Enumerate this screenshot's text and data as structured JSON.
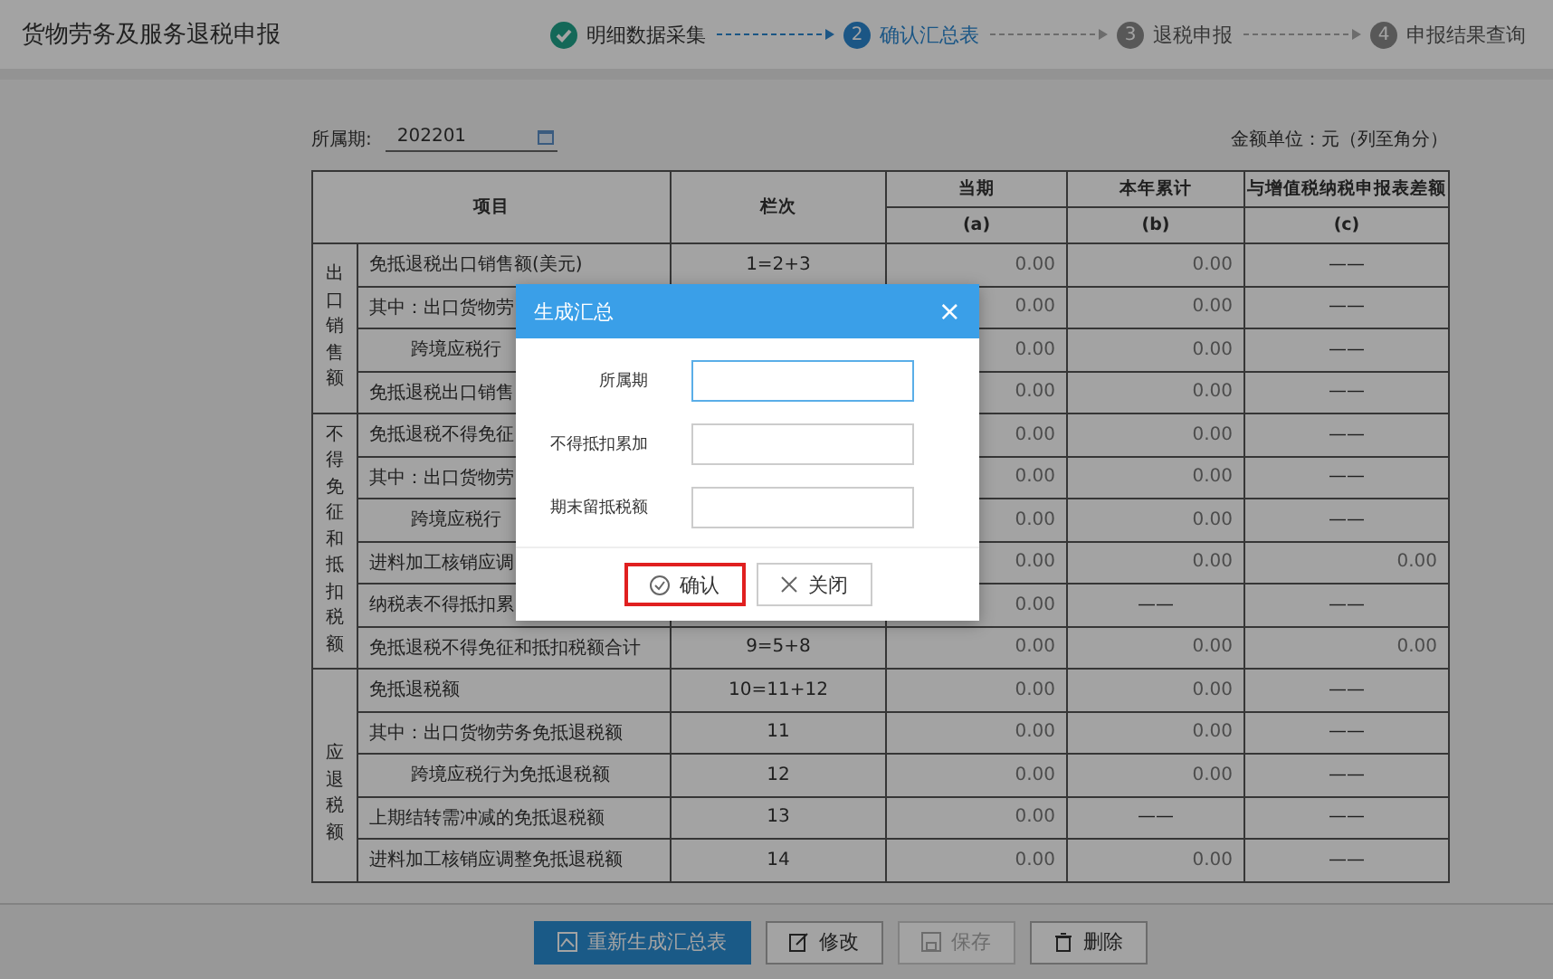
{
  "header": {
    "title": "货物劳务及服务退税申报",
    "steps": [
      {
        "label": "明细数据采集",
        "completed": true,
        "selected": false
      },
      {
        "number": "2",
        "label": "确认汇总表",
        "completed": false,
        "selected": true
      },
      {
        "number": "3",
        "label": "退税申报",
        "completed": false,
        "selected": false
      },
      {
        "number": "4",
        "label": "申报结果查询",
        "completed": false,
        "selected": false
      }
    ]
  },
  "period": {
    "label": "所属期:",
    "value": "202201"
  },
  "unit_note": "金额单位：元（列至角分）",
  "table": {
    "columns": {
      "item": "项目",
      "line": "栏次",
      "a": "当期",
      "b": "本年累计",
      "c": "与增值税纳税申报表差额"
    },
    "subheaders": [
      "(a)",
      "(b)",
      "(c)"
    ],
    "groups": [
      {
        "label": "出口销售额",
        "rows": [
          {
            "item": "免抵退税出口销售额(美元)",
            "kind": "plain",
            "line": "1=2+3",
            "a": "0.00",
            "b": "0.00",
            "c": "——"
          },
          {
            "item": "其中：出口货物劳",
            "kind": "plain",
            "a": "0.00",
            "b": "0.00",
            "c": "——"
          },
          {
            "item": "跨境应税行",
            "kind": "indented",
            "a": "0.00",
            "b": "0.00",
            "c": "——"
          },
          {
            "item": "免抵退税出口销售",
            "kind": "plain",
            "a": "0.00",
            "b": "0.00",
            "c": "——"
          }
        ]
      },
      {
        "label": "不得免征和抵扣税额",
        "rows": [
          {
            "item": "免抵退税不得免征",
            "kind": "plain",
            "a": "0.00",
            "b": "0.00",
            "c": "——"
          },
          {
            "item": "其中：出口货物劳",
            "kind": "plain",
            "a": "0.00",
            "b": "0.00",
            "c": "——"
          },
          {
            "item": "跨境应税行",
            "kind": "indented",
            "a": "0.00",
            "b": "0.00",
            "c": "——"
          },
          {
            "item": "进料加工核销应调",
            "kind": "plain",
            "a": "0.00",
            "b": "0.00",
            "c": "0.00"
          },
          {
            "item": "纳税表不得抵扣累",
            "kind": "plain",
            "a": "0.00",
            "b": "——",
            "c": "——"
          },
          {
            "item": "免抵退税不得免征和抵扣税额合计",
            "kind": "plain",
            "line": "9=5+8",
            "a": "0.00",
            "b": "0.00",
            "c": "0.00"
          }
        ]
      },
      {
        "label": "应退税额",
        "rows": [
          {
            "item": "免抵退税额",
            "kind": "plain",
            "line": "10=11+12",
            "a": "0.00",
            "b": "0.00",
            "c": "——"
          },
          {
            "item": "其中：出口货物劳务免抵退税额",
            "kind": "plain",
            "line": "11",
            "a": "0.00",
            "b": "0.00",
            "c": "——"
          },
          {
            "item": "跨境应税行为免抵退税额",
            "kind": "indented",
            "line": "12",
            "a": "0.00",
            "b": "0.00",
            "c": "——"
          },
          {
            "item": "上期结转需冲减的免抵退税额",
            "kind": "plain",
            "line": "13",
            "a": "0.00",
            "b": "——",
            "c": "——"
          },
          {
            "item": "进料加工核销应调整免抵退税额",
            "kind": "plain",
            "line": "14",
            "a": "0.00",
            "b": "0.00",
            "c": "——"
          }
        ]
      }
    ]
  },
  "toolbar": [
    {
      "label": "重新生成汇总表",
      "kind": "regenerate",
      "primary": true,
      "disabled": false
    },
    {
      "label": "修改",
      "kind": "edit",
      "primary": false,
      "disabled": false
    },
    {
      "label": "保存",
      "kind": "save",
      "primary": false,
      "disabled": true
    },
    {
      "label": "删除",
      "kind": "delete",
      "primary": false,
      "disabled": false
    }
  ],
  "dialog": {
    "title": "生成汇总",
    "close": "×",
    "fields": [
      {
        "label": "所属期",
        "focused": true
      },
      {
        "label": "不得抵扣累加",
        "focused": false
      },
      {
        "label": "期末留抵税额",
        "focused": false
      }
    ],
    "buttons": [
      {
        "label": "确认",
        "kind": "confirm",
        "highlighted": true
      },
      {
        "label": "关闭",
        "kind": "close",
        "highlighted": false
      }
    ]
  }
}
